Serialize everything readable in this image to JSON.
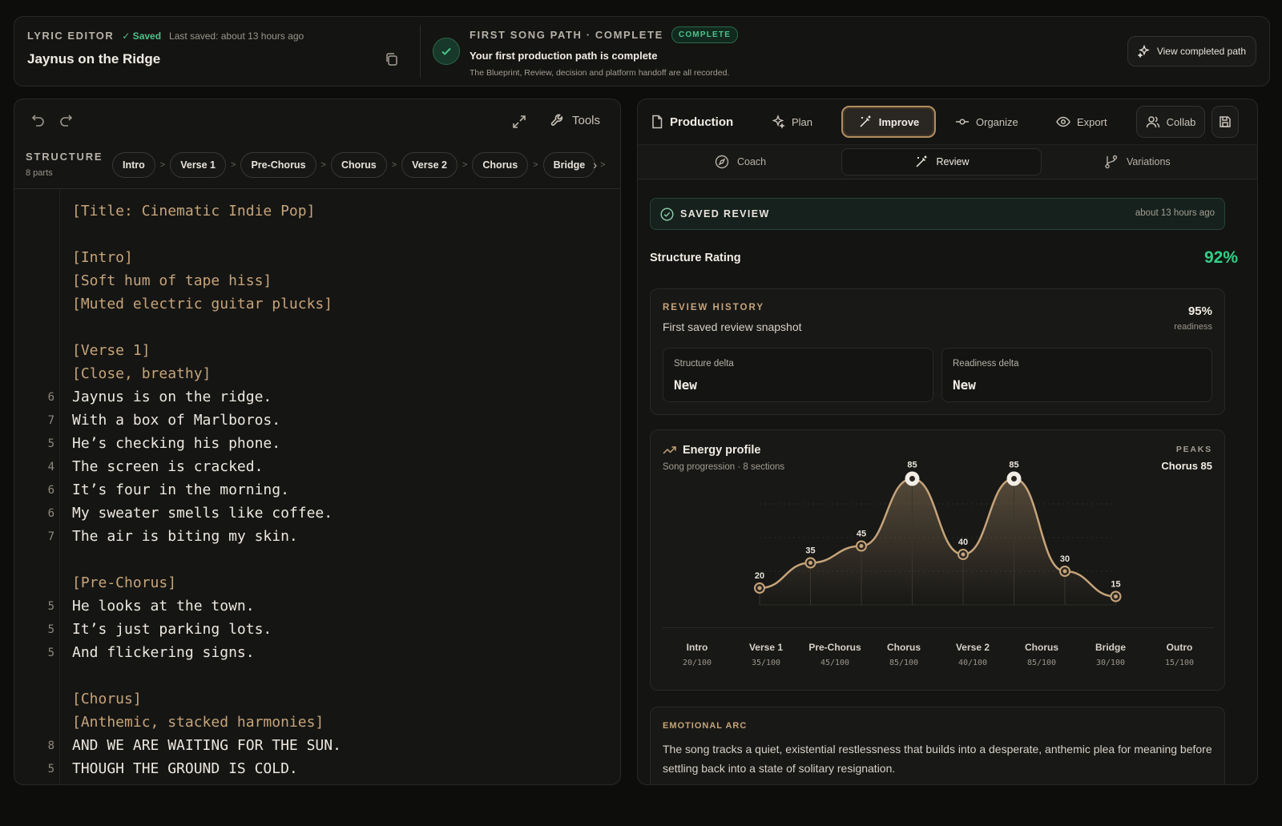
{
  "header": {
    "app_label": "LYRIC EDITOR",
    "saved_status": "✓ Saved",
    "last_saved": "Last saved: about 13 hours ago",
    "song_title": "Jaynus on the Ridge",
    "path_label": "FIRST SONG PATH · COMPLETE",
    "complete_badge": "COMPLETE",
    "path_title": "Your first production path is complete",
    "path_desc": "The Blueprint, Review, decision and platform handoff are all recorded.",
    "view_button": "View completed path"
  },
  "editor": {
    "tools_label": "Tools",
    "structure_label": "STRUCTURE",
    "structure_count": "8 parts",
    "structure_pills": [
      "Intro",
      "Verse 1",
      "Pre-Chorus",
      "Chorus",
      "Verse 2",
      "Chorus",
      "Bridge"
    ],
    "lines": [
      {
        "num": "",
        "text": "[Title: Cinematic Indie Pop]",
        "kind": "tag"
      },
      {
        "num": "",
        "text": "",
        "kind": "blank"
      },
      {
        "num": "",
        "text": "[Intro]",
        "kind": "tag"
      },
      {
        "num": "",
        "text": "[Soft hum of tape hiss]",
        "kind": "tag"
      },
      {
        "num": "",
        "text": "[Muted electric guitar plucks]",
        "kind": "tag"
      },
      {
        "num": "",
        "text": "",
        "kind": "blank"
      },
      {
        "num": "",
        "text": "[Verse 1]",
        "kind": "tag"
      },
      {
        "num": "",
        "text": "[Close, breathy]",
        "kind": "tag"
      },
      {
        "num": "6",
        "text": "Jaynus is on the ridge.",
        "kind": "lyric"
      },
      {
        "num": "7",
        "text": "With a box of Marlboros.",
        "kind": "lyric"
      },
      {
        "num": "5",
        "text": "He’s checking his phone.",
        "kind": "lyric"
      },
      {
        "num": "4",
        "text": "The screen is cracked.",
        "kind": "lyric"
      },
      {
        "num": "6",
        "text": "It’s four in the morning.",
        "kind": "lyric"
      },
      {
        "num": "6",
        "text": "My sweater smells like coffee.",
        "kind": "lyric"
      },
      {
        "num": "7",
        "text": "The air is biting my skin.",
        "kind": "lyric"
      },
      {
        "num": "",
        "text": "",
        "kind": "blank"
      },
      {
        "num": "",
        "text": "[Pre-Chorus]",
        "kind": "tag"
      },
      {
        "num": "5",
        "text": "He looks at the town.",
        "kind": "lyric"
      },
      {
        "num": "5",
        "text": "It’s just parking lots.",
        "kind": "lyric"
      },
      {
        "num": "5",
        "text": "And flickering signs.",
        "kind": "lyric"
      },
      {
        "num": "",
        "text": "",
        "kind": "blank"
      },
      {
        "num": "",
        "text": "[Chorus]",
        "kind": "tag"
      },
      {
        "num": "",
        "text": "[Anthemic, stacked harmonies]",
        "kind": "tag"
      },
      {
        "num": "8",
        "text": "AND WE ARE WAITING FOR THE SUN.",
        "kind": "lyric"
      },
      {
        "num": "5",
        "text": "THOUGH THE GROUND IS COLD.",
        "kind": "lyric"
      }
    ]
  },
  "panel": {
    "tabs": {
      "production": "Production",
      "plan": "Plan",
      "improve": "Improve",
      "organize": "Organize",
      "export": "Export",
      "collab": "Collab"
    },
    "subtabs": {
      "coach": "Coach",
      "review": "Review",
      "variations": "Variations"
    },
    "saved_review": {
      "label": "SAVED REVIEW",
      "time": "about 13 hours ago"
    },
    "structure_rating": {
      "label": "Structure Rating",
      "value": "92%"
    },
    "history": {
      "label": "REVIEW HISTORY",
      "subtitle": "First saved review snapshot",
      "value": "95%",
      "value_caption": "readiness",
      "structure_delta_label": "Structure delta",
      "structure_delta_value": "New",
      "readiness_delta_label": "Readiness delta",
      "readiness_delta_value": "New"
    },
    "energy": {
      "title": "Energy profile",
      "subtitle": "Song progression · 8 sections",
      "peaks_label": "PEAKS",
      "peaks_value": "Chorus  85"
    },
    "emotional_arc": {
      "label": "EMOTIONAL ARC",
      "text": "The song tracks a quiet, existential restlessness that builds into a desperate, anthemic plea for meaning before settling back into a state of solitary resignation."
    },
    "colors": {
      "accent_gold": "#c6a47a",
      "success_green": "#2fd186"
    }
  },
  "chart_data": {
    "type": "line",
    "categories": [
      "Intro",
      "Verse 1",
      "Pre-Chorus",
      "Chorus",
      "Verse 2",
      "Chorus",
      "Bridge",
      "Outro"
    ],
    "values": [
      20,
      35,
      45,
      85,
      40,
      85,
      30,
      15
    ],
    "value_labels": [
      "20/100",
      "35/100",
      "45/100",
      "85/100",
      "40/100",
      "85/100",
      "30/100",
      "15/100"
    ],
    "ylim": [
      0,
      100
    ],
    "peaks": [
      "Chorus",
      "Chorus"
    ],
    "grid": true
  }
}
